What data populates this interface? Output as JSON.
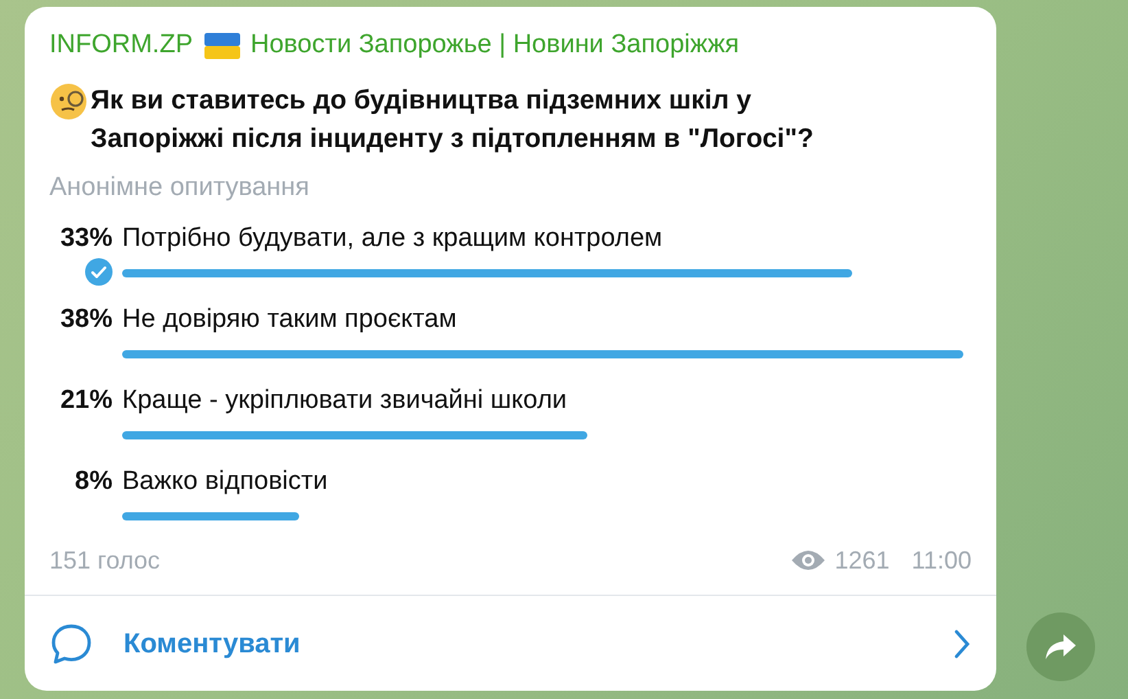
{
  "channel": {
    "name": "INFORM.ZP",
    "title": "Новости Запорожье | Новини Запоріжжя"
  },
  "poll": {
    "question": "Як ви ставитесь до будівництва підземних шкіл у Запоріжжі після інциденту з підтопленням в \"Логосі\"?",
    "type": "Анонімне опитування",
    "options": [
      {
        "percent": "33%",
        "label": "Потрібно будувати, але з кращим контролем",
        "chosen": true
      },
      {
        "percent": "38%",
        "label": "Не довіряю таким проєктам",
        "chosen": false
      },
      {
        "percent": "21%",
        "label": "Краще - укріплювати звичайні школи",
        "chosen": false
      },
      {
        "percent": "8%",
        "label": "Важко відповісти",
        "chosen": false
      }
    ],
    "votes": "151 голос"
  },
  "views": "1261",
  "time": "11:00",
  "comment_button": "Коментувати"
}
